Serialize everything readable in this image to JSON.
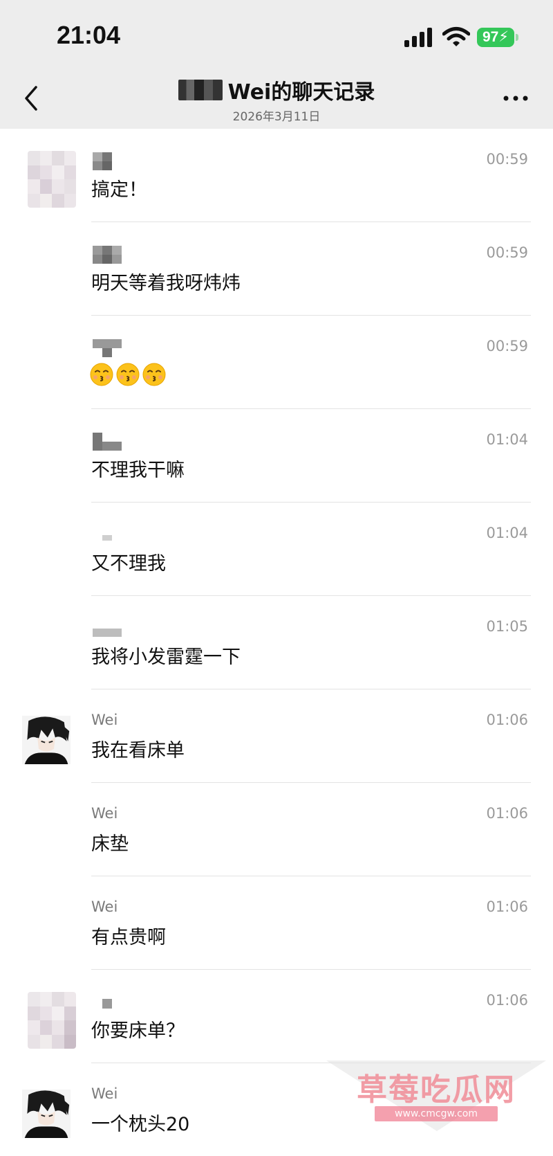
{
  "status_bar": {
    "time": "21:04",
    "battery": "97",
    "icons": [
      "cellular-signal-icon",
      "wifi-icon",
      "battery-charging-icon"
    ]
  },
  "header": {
    "title": "Wei的聊天记录",
    "date": "2026年3月11日",
    "back_icon": "chevron-left-icon",
    "more_icon": "more-horizontal-icon"
  },
  "messages": [
    {
      "sender": "",
      "time": "00:59",
      "text": "搞定！",
      "avatar": "mosaic"
    },
    {
      "sender": "",
      "time": "00:59",
      "text": "明天等着我呀炜炜",
      "avatar": ""
    },
    {
      "sender": "",
      "time": "00:59",
      "text": "",
      "emoji": [
        "kissing-face-icon",
        "kissing-face-icon",
        "kissing-face-icon"
      ],
      "avatar": ""
    },
    {
      "sender": "",
      "time": "01:04",
      "text": "不理我干嘛",
      "avatar": ""
    },
    {
      "sender": "",
      "time": "01:04",
      "text": "又不理我",
      "avatar": ""
    },
    {
      "sender": "",
      "time": "01:05",
      "text": "我将小发雷霆一下",
      "avatar": ""
    },
    {
      "sender": "Wei",
      "time": "01:06",
      "text": "我在看床单",
      "avatar": "anime"
    },
    {
      "sender": "Wei",
      "time": "01:06",
      "text": "床垫",
      "avatar": ""
    },
    {
      "sender": "Wei",
      "time": "01:06",
      "text": "有点贵啊",
      "avatar": ""
    },
    {
      "sender": "",
      "time": "01:06",
      "text": "你要床单？",
      "avatar": "mosaic"
    },
    {
      "sender": "Wei",
      "time": "",
      "text": "一个枕头20",
      "avatar": "anime"
    }
  ],
  "watermark": {
    "text": "草莓吃瓜网",
    "url": "www.cmcgw.com"
  }
}
